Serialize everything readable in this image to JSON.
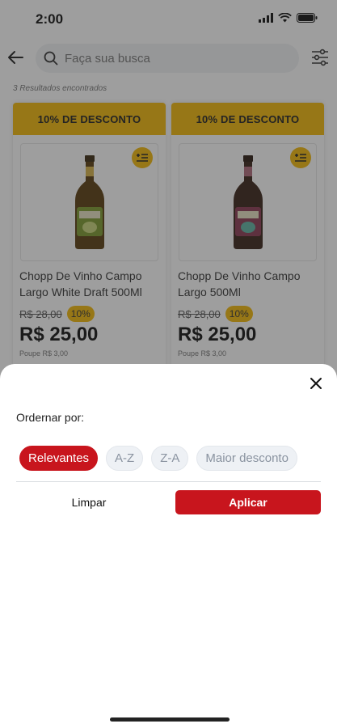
{
  "status_bar": {
    "time": "2:00",
    "icons": [
      "signal-icon",
      "wifi-icon",
      "battery-icon"
    ]
  },
  "search": {
    "placeholder": "Faça sua busca"
  },
  "results": {
    "count_text": "3 Resultados encontrados"
  },
  "products": [
    {
      "banner": "10% DE DESCONTO",
      "name": "Chopp De Vinho Campo Largo White Draft 500Ml",
      "old_price": "R$ 28,00",
      "discount_badge": "10%",
      "price": "R$ 25,00",
      "savings": "Poupe R$ 3,00"
    },
    {
      "banner": "10% DE DESCONTO",
      "name": "Chopp De Vinho Campo Largo 500Ml",
      "old_price": "R$ 28,00",
      "discount_badge": "10%",
      "price": "R$ 25,00",
      "savings": "Poupe R$ 3,00"
    }
  ],
  "sort_sheet": {
    "label": "Ordernar por:",
    "options": [
      "Relevantes",
      "A-Z",
      "Z-A",
      "Maior desconto"
    ],
    "selected": "Relevantes",
    "clear_label": "Limpar",
    "apply_label": "Aplicar"
  },
  "colors": {
    "accent_red": "#c8151d",
    "discount_yellow": "#f3b90a",
    "chip_bg": "#eef1f5"
  }
}
